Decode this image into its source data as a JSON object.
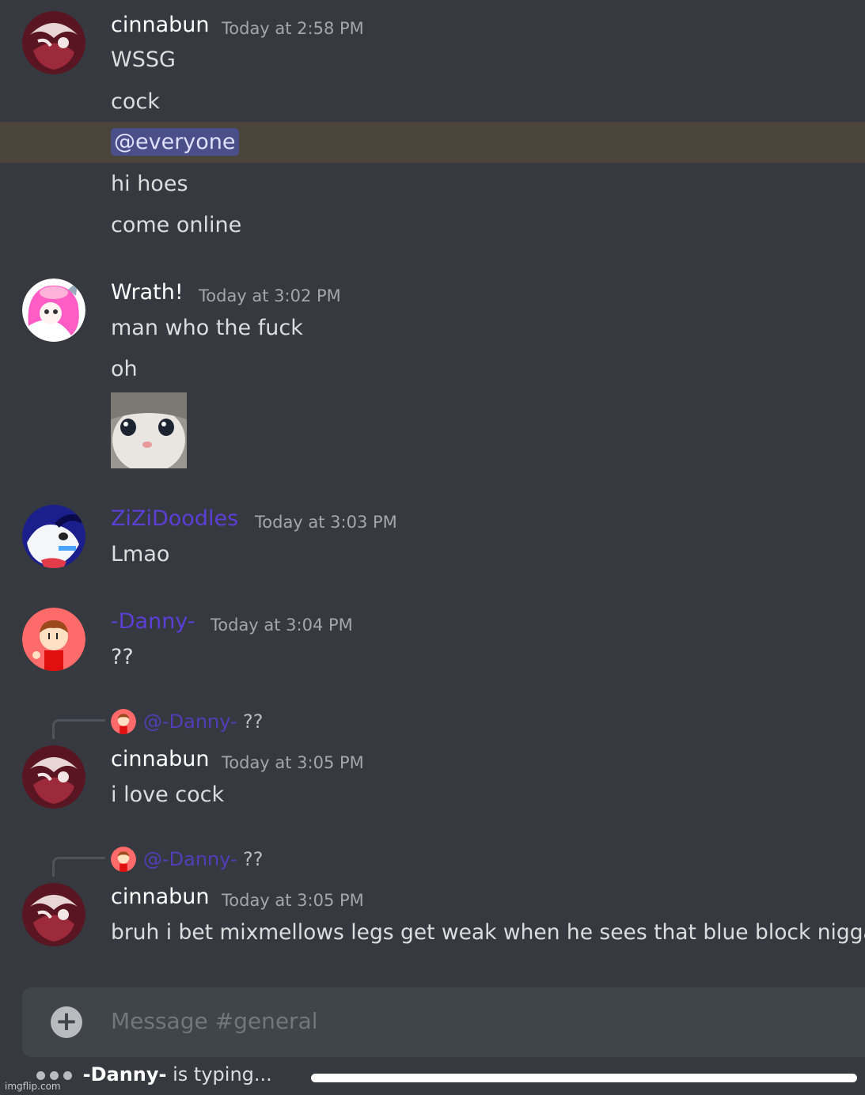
{
  "messages": [
    {
      "user": "cinnabun",
      "time": "Today at 2:58 PM",
      "lines": [
        "WSSG",
        "cock",
        "@everyone",
        "hi hoes",
        "come online"
      ]
    },
    {
      "user": "Wrath!",
      "time": "Today at 3:02 PM",
      "lines": [
        "man who the fuck",
        "oh"
      ]
    },
    {
      "user": "ZiZiDoodles",
      "time": "Today at 3:03 PM",
      "lines": [
        "Lmao"
      ]
    },
    {
      "user": "-Danny-",
      "time": "Today at 3:04 PM",
      "lines": [
        "??"
      ]
    },
    {
      "user": "cinnabun",
      "time": "Today at 3:05 PM",
      "reply": {
        "name": "@-Danny-",
        "text": "??"
      },
      "lines": [
        "i love cock"
      ]
    },
    {
      "user": "cinnabun",
      "time": "Today at 3:05 PM",
      "reply": {
        "name": "@-Danny-",
        "text": "??"
      },
      "lines": [
        "bruh i bet mixmellows legs get weak when he sees that blue block nigga"
      ]
    }
  ],
  "composer": {
    "placeholder": "Message #general",
    "plus_icon": "+"
  },
  "typing": {
    "name": "-Danny-",
    "text": " is typing..."
  },
  "watermark": "imgflip.com",
  "colors": {
    "background": "#36393f",
    "mention_highlight": "#4a443a",
    "role_purple": "#5b3fd6"
  }
}
